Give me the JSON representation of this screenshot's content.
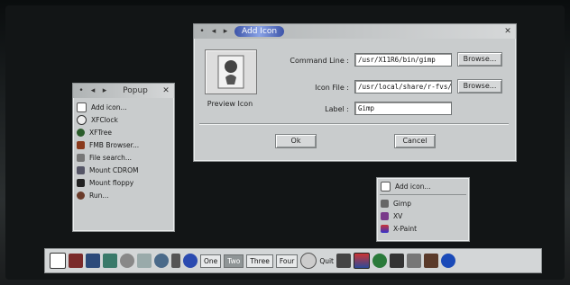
{
  "add_icon_dialog": {
    "title": "Add Icon",
    "preview_label": "Preview Icon",
    "command_line_label": "Command Line :",
    "command_line_value": "/usr/X11R6/bin/gimp",
    "icon_file_label": "Icon File :",
    "icon_file_value": "/usr/local/share/r-fvs/",
    "label_label": "Label :",
    "label_value": "Gimp",
    "browse_label": "Browse...",
    "ok_label": "Ok",
    "cancel_label": "Cancel"
  },
  "popup_window": {
    "title": "Popup",
    "items": [
      {
        "label": "Add icon...",
        "icon": "doc-icon"
      },
      {
        "label": "XFClock",
        "icon": "clock-icon"
      },
      {
        "label": "XFTree",
        "icon": "tree-icon"
      },
      {
        "label": "FMB Browser...",
        "icon": "browser-icon"
      },
      {
        "label": "File search...",
        "icon": "search-icon"
      },
      {
        "label": "Mount CDROM",
        "icon": "cdrom-icon"
      },
      {
        "label": "Mount floppy",
        "icon": "floppy-icon"
      },
      {
        "label": "Run...",
        "icon": "run-icon"
      }
    ]
  },
  "graphics_menu": {
    "items": [
      {
        "label": "Add icon...",
        "icon": "doc-icon"
      },
      {
        "label": "Gimp",
        "icon": "gimp-icon"
      },
      {
        "label": "XV",
        "icon": "xv-icon"
      },
      {
        "label": "X-Paint",
        "icon": "paint-icon"
      }
    ]
  },
  "panel": {
    "workspaces": [
      "One",
      "Two",
      "Three",
      "Four"
    ],
    "quit_label": "Quit"
  },
  "colors": {
    "title_active": "#3d54a8",
    "panel": "#d3d6d7",
    "window": "#c9cccd"
  }
}
